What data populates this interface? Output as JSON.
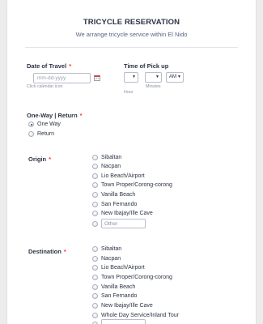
{
  "form": {
    "title": "TRICYCLE RESERVATION",
    "subtitle": "We arrange tricycle service within El Nido"
  },
  "date_of_travel": {
    "label": "Date of Travel",
    "required_mark": "*",
    "placeholder": "mm-dd-yyyy",
    "sublabel": "Click calendar icon",
    "calendar_icon": "calendar-icon"
  },
  "time_of_pickup": {
    "label": "Time of Pick up",
    "hour_value": "",
    "minutes_value": "",
    "ampm_value": "AM",
    "separator": ":",
    "hour_sublabel": "Hour",
    "minutes_sublabel": "Minutes"
  },
  "trip_type": {
    "label": "One-Way | Return",
    "required_mark": "*",
    "options": [
      {
        "label": "One Way",
        "checked": true
      },
      {
        "label": "Return",
        "checked": false
      }
    ]
  },
  "origin": {
    "label": "Origin",
    "required_mark": "*",
    "options": [
      "Sibaltan",
      "Nacpan",
      "Lio Beach/Airport",
      "Town Proper/Corong-corong",
      "Vanilla Beach",
      "San Fernando",
      "New Ibajay/Ille Cave"
    ],
    "other_placeholder": "Other"
  },
  "destination": {
    "label": "Destination",
    "required_mark": "*",
    "options": [
      "Sibaltan",
      "Nacpan",
      "Lio Beach/Airport",
      "Town Proper/Corong-corong",
      "Vanilla Beach",
      "San Fernando",
      "New Ibajay/Ille Cave",
      "Whole Day Service/Inland Tour"
    ]
  }
}
